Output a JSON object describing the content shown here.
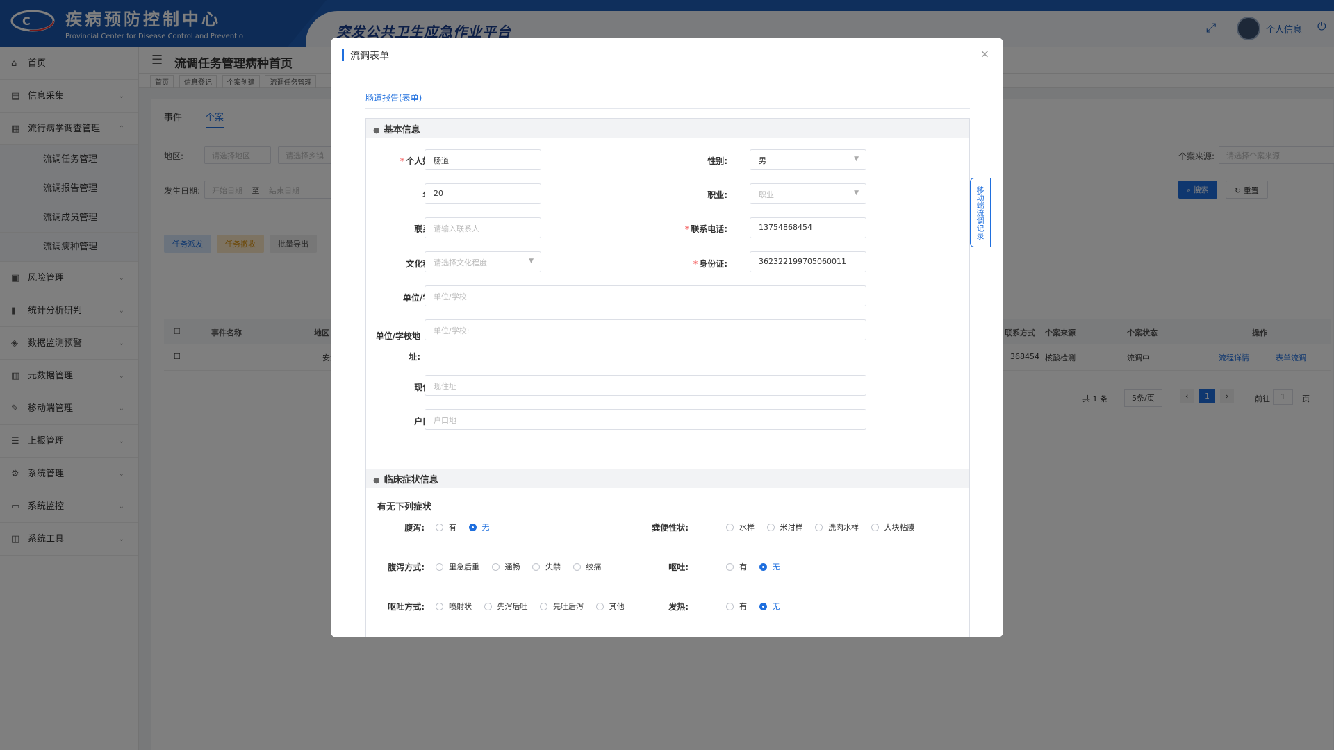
{
  "header": {
    "org_name_cn": "疾病预防控制中心",
    "org_name_en": "Provincial Center for Disease Control and Preventio",
    "platform_title": "突发公共卫生应急作业平台",
    "user_label": "个人信息"
  },
  "sidebar": {
    "items": [
      {
        "label": "首页",
        "icon": "home-icon"
      },
      {
        "label": "信息采集",
        "icon": "collect-icon"
      },
      {
        "label": "流行病学调查管理",
        "icon": "survey-icon",
        "expanded": true
      },
      {
        "label": "风险管理",
        "icon": "risk-icon"
      },
      {
        "label": "统计分析研判",
        "icon": "chart-icon"
      },
      {
        "label": "数据监测预警",
        "icon": "monitor-icon"
      },
      {
        "label": "元数据管理",
        "icon": "metadata-icon"
      },
      {
        "label": "移动端管理",
        "icon": "mobile-icon"
      },
      {
        "label": "上报管理",
        "icon": "report-icon"
      },
      {
        "label": "系统管理",
        "icon": "gear-icon"
      },
      {
        "label": "系统监控",
        "icon": "screen-icon"
      },
      {
        "label": "系统工具",
        "icon": "tools-icon"
      }
    ],
    "sub_items": [
      "流调任务管理",
      "流调报告管理",
      "流调成员管理",
      "流调病种管理"
    ]
  },
  "page": {
    "title": "流调任务管理病种首页",
    "breadcrumbs": [
      "首页",
      "信息登记",
      "个案创建",
      "流调任务管理"
    ],
    "tabs": [
      "事件",
      "个案"
    ],
    "filters": {
      "region_label": "地区:",
      "region_ph": "请选择地区",
      "town_ph": "请选择乡镇",
      "source_label": "个案来源:",
      "source_ph": "请选择个案来源",
      "date_label": "发生日期:",
      "start_ph": "开始日期",
      "to": "至",
      "end_ph": "结束日期",
      "search_btn": "搜索",
      "reset_btn": "重置"
    },
    "actions": [
      "任务派发",
      "任务撤收",
      "批量导出"
    ],
    "table": {
      "headers": [
        "事件名称",
        "地区",
        "联系方式",
        "个案来源",
        "个案状态",
        "操作"
      ],
      "row": {
        "region": "安源区",
        "phone": "368454",
        "source": "核酸检测",
        "status": "流调中",
        "op1": "流程详情",
        "op2": "表单流调"
      }
    },
    "pager": {
      "total": "共 1 条",
      "size": "5条/页",
      "page": "1",
      "goto": "前往",
      "goto_val": "1",
      "unit": "页"
    }
  },
  "modal": {
    "title": "流调表单",
    "tab": "肠道报告(表单)",
    "side_tab": "移动端流调记录",
    "section_basic": "基本信息",
    "fields": {
      "name_label": "个人姓名:",
      "name_value": "肠道",
      "gender_label": "性别:",
      "gender_value": "男",
      "age_label": "年龄:",
      "age_value": "20",
      "job_label": "职业:",
      "job_ph": "职业",
      "contact_label": "联系人:",
      "contact_ph": "请输入联系人",
      "phone_label": "联系电话:",
      "phone_value": "13754868454",
      "edu_label": "文化程度:",
      "edu_ph": "请选择文化程度",
      "id_label": "身份证:",
      "id_value": "362322199705060011",
      "unit_label": "单位/学校:",
      "unit_ph": "单位/学校",
      "unit_addr_label": "单位/学校地址:",
      "unit_addr_ph": "单位/学校:",
      "addr_label": "现住址:",
      "addr_ph": "现住址",
      "hukou_label": "户口地:",
      "hukou_ph": "户口地"
    },
    "section_clinical": "临床症状信息",
    "symptoms_title": "有无下列症状",
    "symptoms": {
      "diarrhea_label": "腹泻:",
      "diarrhea_options": [
        "有",
        "无"
      ],
      "diarrhea_selected": 1,
      "stool_label": "粪便性状:",
      "stool_options": [
        "水样",
        "米泔样",
        "洗肉水样",
        "大块粘膜"
      ],
      "diarrhea_mode_label": "腹泻方式:",
      "diarrhea_mode_options": [
        "里急后重",
        "通畅",
        "失禁",
        "绞痛"
      ],
      "vomit_label": "呕吐:",
      "vomit_options": [
        "有",
        "无"
      ],
      "vomit_selected": 1,
      "vomit_mode_label": "呕吐方式:",
      "vomit_mode_options": [
        "喷射状",
        "先泻后吐",
        "先吐后泻",
        "其他"
      ],
      "fever_label": "发热:",
      "fever_options": [
        "有",
        "无"
      ],
      "fever_selected": 1
    }
  }
}
